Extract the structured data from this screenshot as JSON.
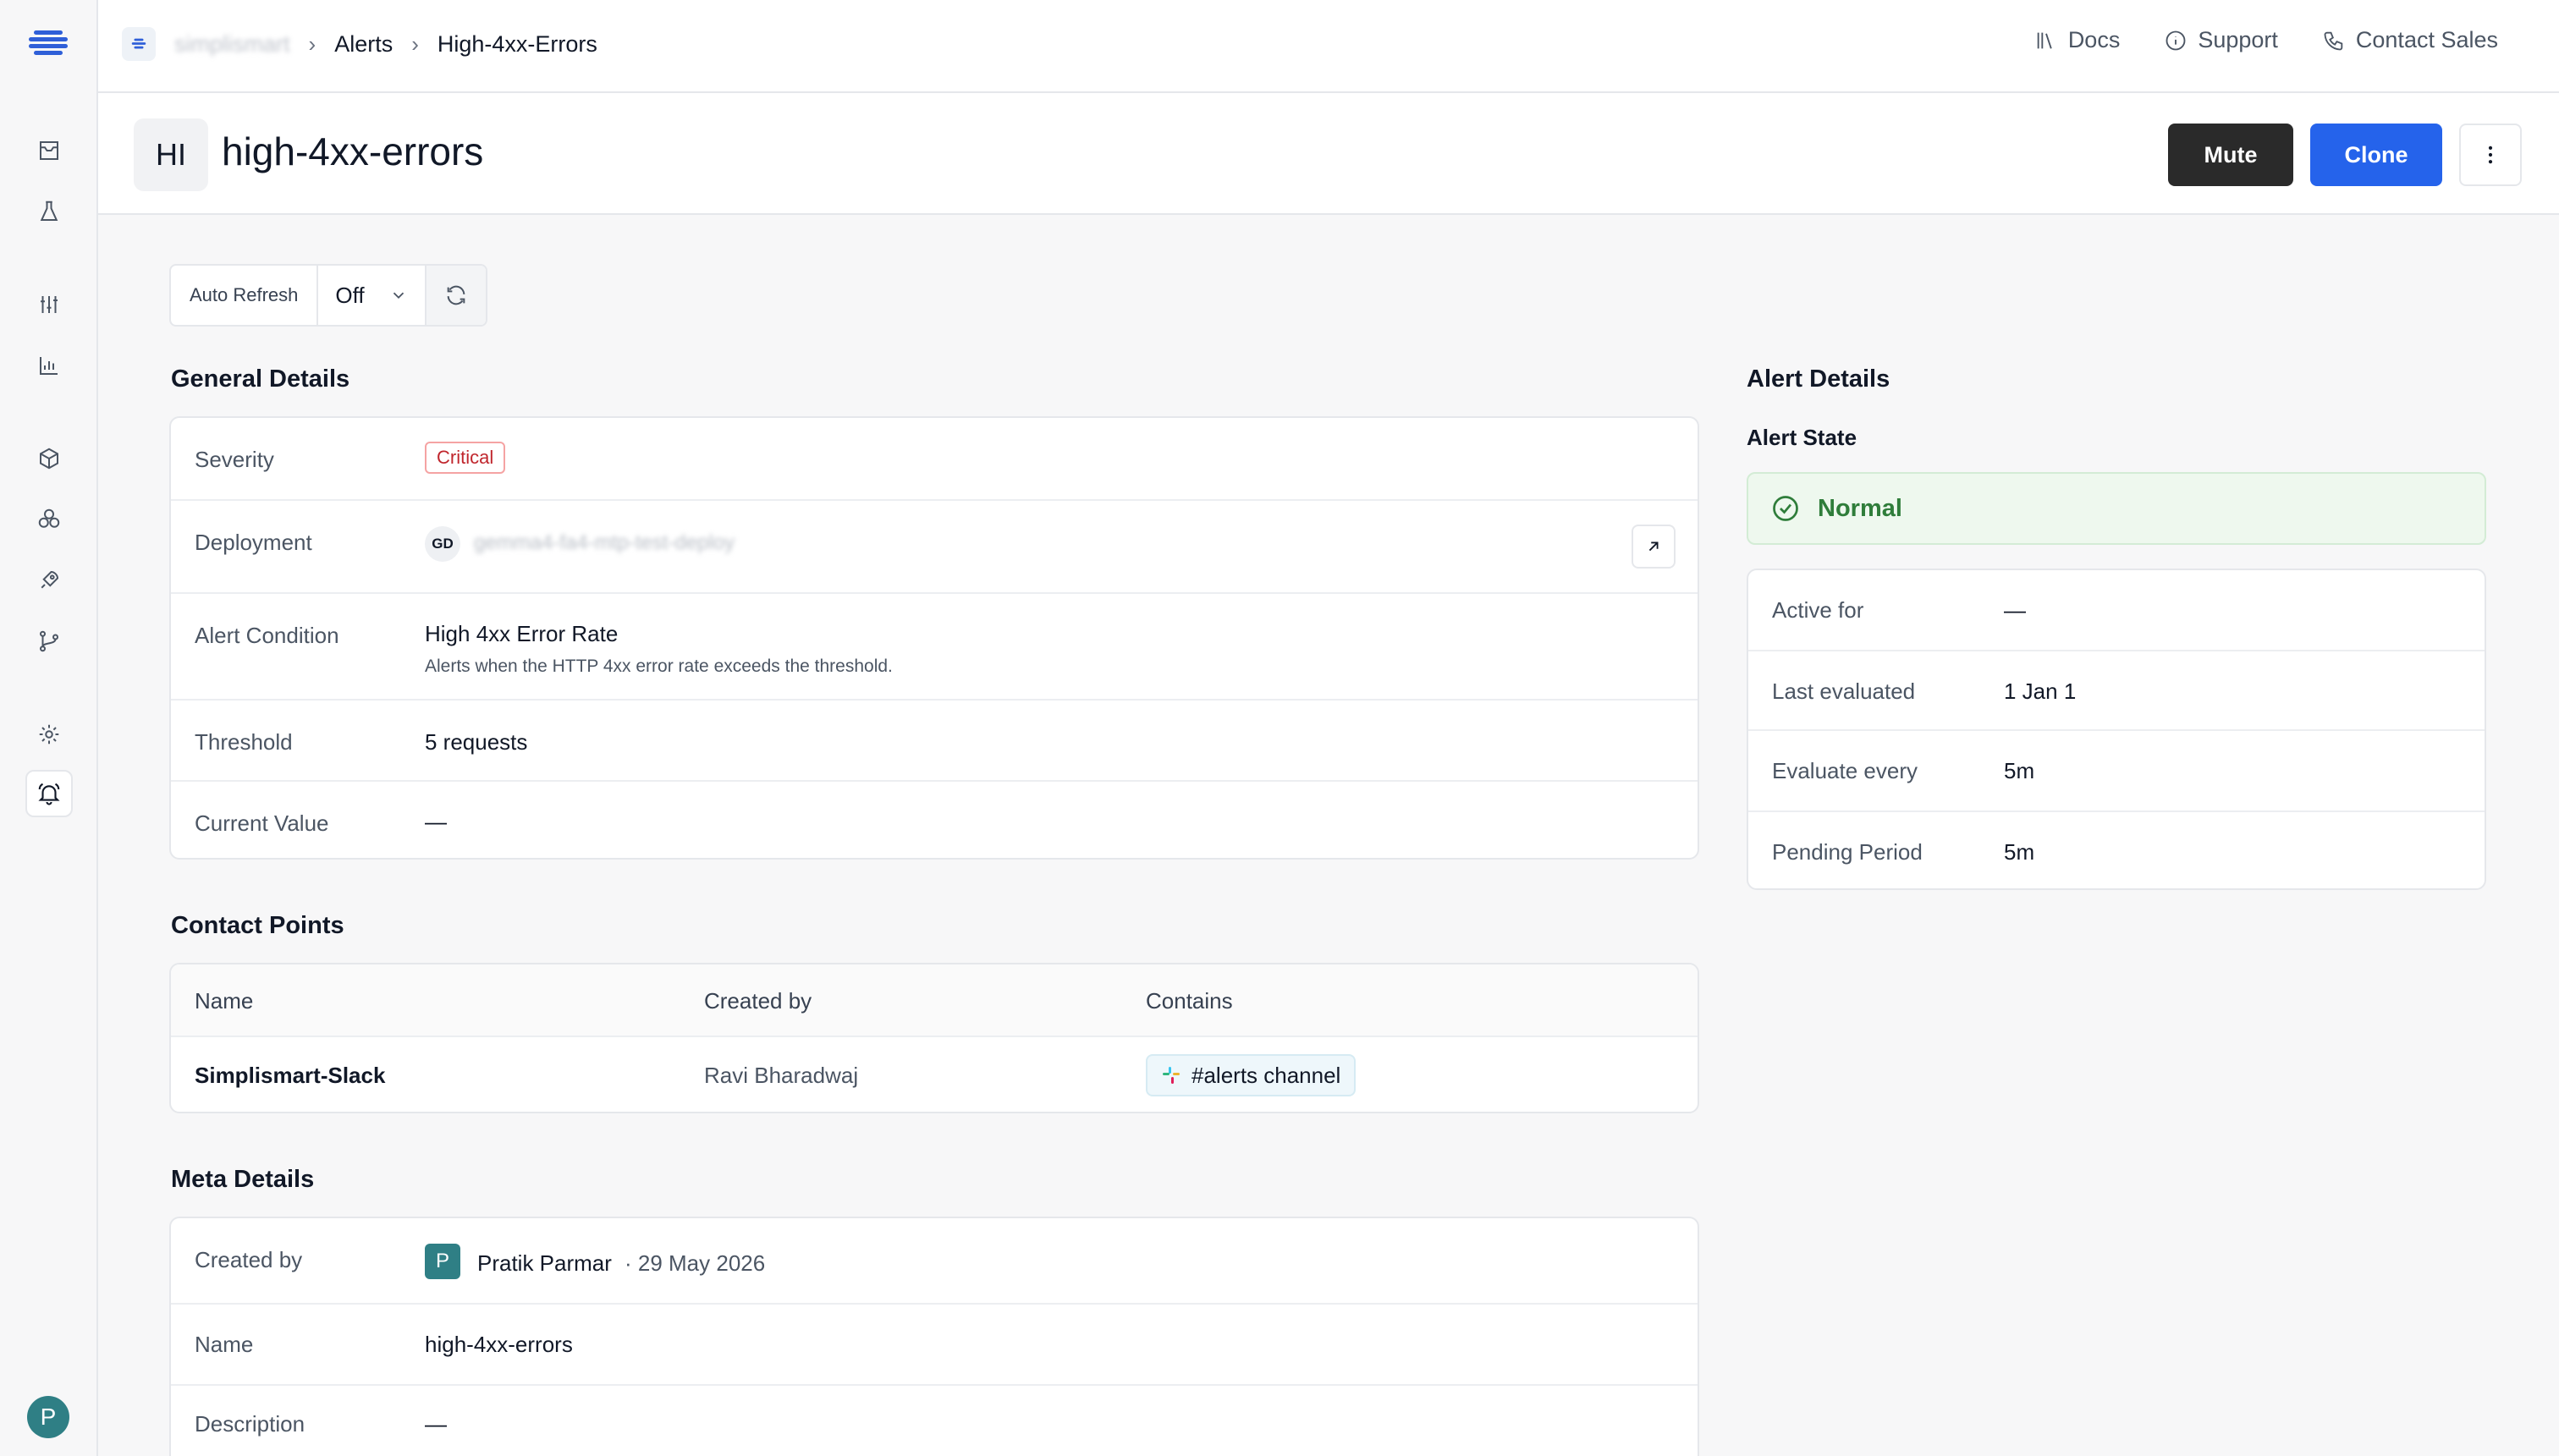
{
  "breadcrumbs": {
    "org": "simplismart",
    "items": [
      "Alerts",
      "High-4xx-Errors"
    ]
  },
  "toplinks": {
    "docs": "Docs",
    "support": "Support",
    "contact_sales": "Contact Sales"
  },
  "header": {
    "initials": "HI",
    "title": "high-4xx-errors",
    "mute_label": "Mute",
    "clone_label": "Clone"
  },
  "auto_refresh": {
    "label": "Auto Refresh",
    "value": "Off"
  },
  "general": {
    "title": "General Details",
    "severity_label": "Severity",
    "severity_value": "Critical",
    "deployment_label": "Deployment",
    "deployment_initials": "GD",
    "deployment_value": "gemma4-fa4-mtp-test-deploy",
    "condition_label": "Alert Condition",
    "condition_value": "High 4xx Error Rate",
    "condition_desc": "Alerts when the HTTP 4xx error rate exceeds the threshold.",
    "threshold_label": "Threshold",
    "threshold_value": "5 requests",
    "current_label": "Current Value",
    "current_value": "—"
  },
  "contact_points": {
    "title": "Contact Points",
    "headers": [
      "Name",
      "Created by",
      "Contains"
    ],
    "rows": [
      {
        "name": "Simplismart-Slack",
        "created_by": "Ravi Bharadwaj",
        "contains": "#alerts channel"
      }
    ]
  },
  "meta": {
    "title": "Meta Details",
    "created_by_label": "Created by",
    "creator_initial": "P",
    "creator_name": "Pratik Parmar",
    "created_date": "· 29 May 2026",
    "name_label": "Name",
    "name_value": "high-4xx-errors",
    "description_label": "Description",
    "description_value": "—"
  },
  "alert_details": {
    "title": "Alert Details",
    "state_title": "Alert State",
    "state_value": "Normal",
    "active_for_label": "Active for",
    "active_for_value": "—",
    "last_eval_label": "Last evaluated",
    "last_eval_value": "1 Jan 1",
    "eval_every_label": "Evaluate every",
    "eval_every_value": "5m",
    "pending_label": "Pending Period",
    "pending_value": "5m"
  },
  "user": {
    "initial": "P"
  },
  "colors": {
    "accent": "#2563eb",
    "critical": "#c0262d",
    "normal": "#2f7d3a",
    "dark_button": "#2a2a2a"
  },
  "icons": {
    "rail": [
      "logo-icon",
      "inbox-icon",
      "flask-icon",
      "sliders-icon",
      "chart-icon",
      "cube-icon",
      "clusters-icon",
      "rocket-icon",
      "git-branch-icon",
      "gear-icon",
      "bell-icon"
    ]
  }
}
